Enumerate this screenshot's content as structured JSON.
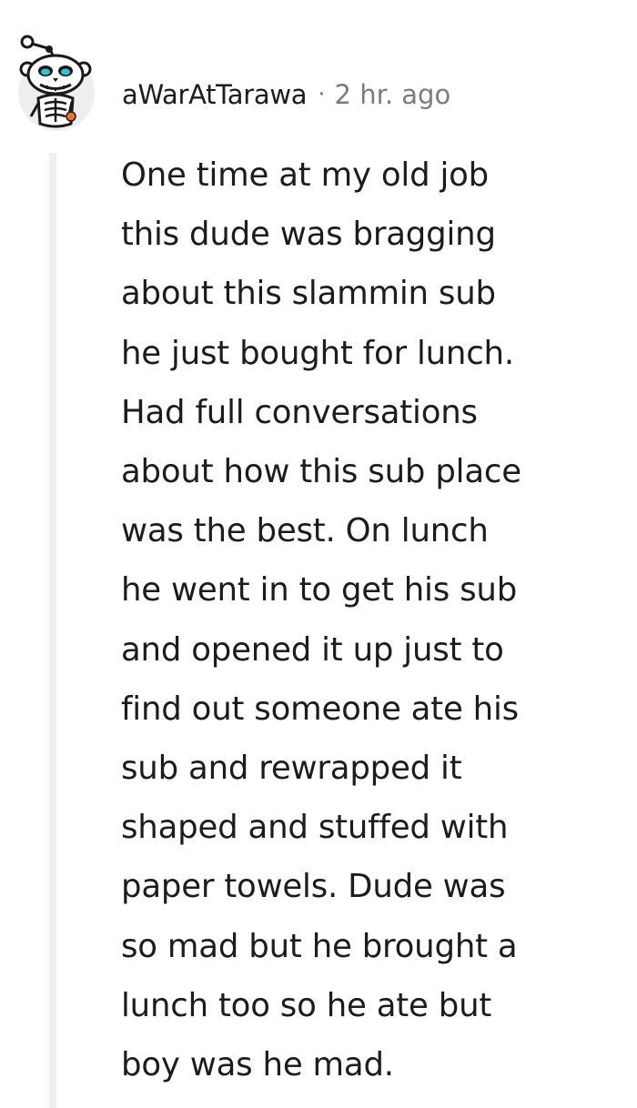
{
  "comment": {
    "username": "aWarAtTarawa",
    "separator": "·",
    "timestamp": "2 hr. ago",
    "avatar_icon": "skeleton-snoo-avatar-icon",
    "text": "One time at my old job\nthis dude was bragging\nabout this slammin sub\nhe just bought for lunch.\nHad full conversations\nabout how this sub place\nwas the best. On lunch\nhe went in to get his sub\nand opened it up just to\nfind out someone ate his\nsub and rewrapped it\nshaped and stuffed with\npaper towels. Dude was\nso mad but he brought a\nlunch too so he ate but\nboy was he mad."
  },
  "colors": {
    "text": "#1c1c1c",
    "meta": "#7c7c7c",
    "thread_line": "#edeff1"
  }
}
